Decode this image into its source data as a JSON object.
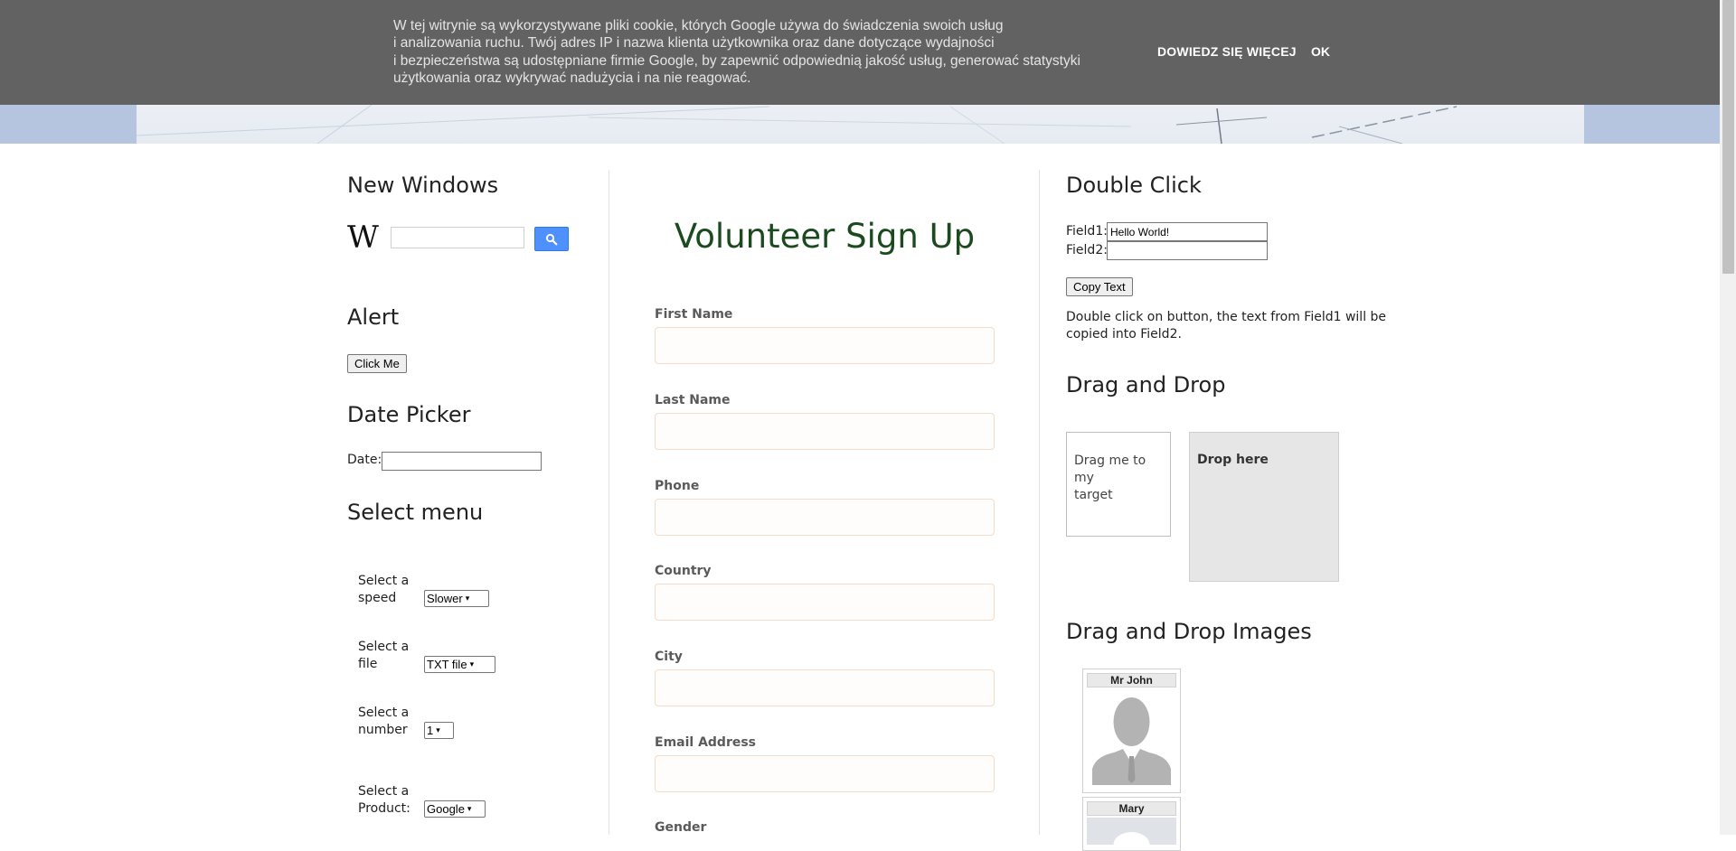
{
  "cookie_bar": {
    "message_lines": [
      "W tej witrynie są wykorzystywane pliki cookie, których Google używa do świadczenia swoich usług",
      "i analizowania ruchu. Twój adres IP i nazwa klienta użytkownika oraz dane dotyczące wydajności",
      "i bezpieczeństwa są udostępniane firmie Google, by zapewnić odpowiednią jakość usług, generować statystyki",
      "użytkowania oraz wykrywać nadużycia i na nie reagować."
    ],
    "learn_more": "DOWIEDZ SIĘ WIĘCEJ",
    "ok": "OK"
  },
  "left": {
    "new_windows_title": "New Windows",
    "wiki_logo": "W",
    "search_value": "",
    "alert_title": "Alert",
    "alert_button": "Click Me",
    "date_picker_title": "Date Picker",
    "date_label": "Date:",
    "date_value": "",
    "select_menu_title": "Select menu",
    "selects": [
      {
        "label_line1": "Select a",
        "label_line2": "speed",
        "value": "Slower"
      },
      {
        "label_line1": "Select a",
        "label_line2": "file",
        "value": "TXT file"
      },
      {
        "label_line1": "Select a",
        "label_line2": "number",
        "value": "1"
      },
      {
        "label_line1": "Select a",
        "label_line2": "Product:",
        "value": "Google"
      }
    ]
  },
  "form": {
    "title": "Volunteer Sign Up",
    "fields": [
      {
        "label": "First Name",
        "value": ""
      },
      {
        "label": "Last Name",
        "value": ""
      },
      {
        "label": "Phone",
        "value": ""
      },
      {
        "label": "Country",
        "value": ""
      },
      {
        "label": "City",
        "value": ""
      },
      {
        "label": "Email Address",
        "value": ""
      }
    ],
    "gender_label": "Gender"
  },
  "right": {
    "double_click_title": "Double Click",
    "field1_label": "Field1:",
    "field1_value": "Hello World!",
    "field2_label": "Field2:",
    "field2_value": "",
    "copy_button": "Copy Text",
    "copy_desc_line1": "Double click on button, the text from Field1 will be",
    "copy_desc_line2": "copied into Field2.",
    "drag_drop_title": "Drag and Drop",
    "drag_line1": "Drag me to my",
    "drag_line2": "target",
    "drop_text": "Drop here",
    "drag_images_title": "Drag and Drop Images",
    "images": [
      {
        "name": "Mr John"
      },
      {
        "name": "Mary"
      }
    ]
  },
  "colors": {
    "cookie_bg": "#626262",
    "header_band": "#b6c5df",
    "form_title": "#1c4a1f",
    "search_button": "#4d90fe"
  }
}
